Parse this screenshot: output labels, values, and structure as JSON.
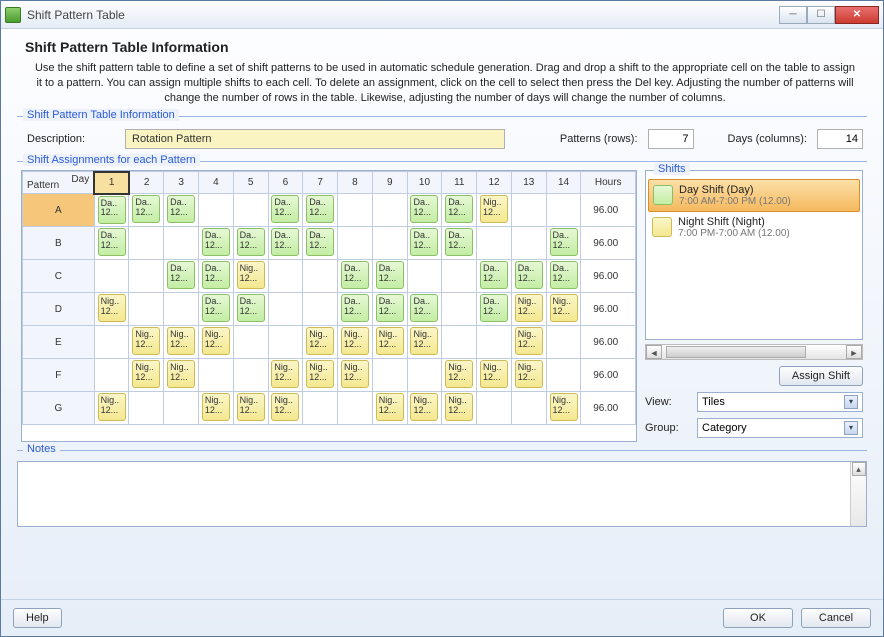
{
  "window": {
    "title": "Shift Pattern Table"
  },
  "page": {
    "heading": "Shift Pattern Table Information",
    "instructions": "Use the shift pattern table to define a set of shift patterns to be used in automatic schedule generation. Drag and drop a shift to the appropriate cell on the table to assign it to a pattern. You can assign multiple shifts to each cell. To delete an assignment, click on the cell to select then press the Del key.  Adjusting the number of patterns will change the number of rows in the table. Likewise, adjusting the number of days will change the number of columns."
  },
  "info": {
    "legend": "Shift Pattern Table Information",
    "description_label": "Description:",
    "description_value": "Rotation Pattern",
    "patterns_label": "Patterns (rows):",
    "patterns_value": "7",
    "days_label": "Days (columns):",
    "days_value": "14"
  },
  "assignments": {
    "legend": "Shift Assignments for each Pattern",
    "corner_day": "Day",
    "corner_pattern": "Pattern",
    "day_headers": [
      "1",
      "2",
      "3",
      "4",
      "5",
      "6",
      "7",
      "8",
      "9",
      "10",
      "11",
      "12",
      "13",
      "14"
    ],
    "hours_header": "Hours",
    "chip_day_top": "Da..",
    "chip_day_bot": "12...",
    "chip_night_top": "Nig..",
    "chip_night_bot": "12...",
    "rows": [
      {
        "label": "A",
        "hours": "96.00",
        "cells": [
          "D",
          "D",
          "D",
          "",
          "",
          "D",
          "D",
          "",
          "",
          "D",
          "D",
          "N",
          "",
          ""
        ]
      },
      {
        "label": "B",
        "hours": "96.00",
        "cells": [
          "D",
          "",
          "",
          "D",
          "D",
          "D",
          "D",
          "",
          "",
          "D",
          "D",
          "",
          "",
          "D"
        ]
      },
      {
        "label": "C",
        "hours": "96.00",
        "cells": [
          "",
          "",
          "D",
          "D",
          "N",
          "",
          "",
          "D",
          "D",
          "",
          "",
          "D",
          "D",
          "D"
        ]
      },
      {
        "label": "D",
        "hours": "96.00",
        "cells": [
          "N",
          "",
          "",
          "D",
          "D",
          "",
          "",
          "D",
          "D",
          "D",
          "",
          "D",
          "N",
          "N"
        ]
      },
      {
        "label": "E",
        "hours": "96.00",
        "cells": [
          "",
          "N",
          "N",
          "N",
          "",
          "",
          "N",
          "N",
          "N",
          "N",
          "",
          "",
          "N",
          ""
        ]
      },
      {
        "label": "F",
        "hours": "96.00",
        "cells": [
          "",
          "N",
          "N",
          "",
          "",
          "N",
          "N",
          "N",
          "",
          "",
          "N",
          "N",
          "N",
          ""
        ]
      },
      {
        "label": "G",
        "hours": "96.00",
        "cells": [
          "N",
          "",
          "",
          "N",
          "N",
          "N",
          "",
          "",
          "N",
          "N",
          "N",
          "",
          "",
          "N"
        ]
      }
    ]
  },
  "shifts": {
    "legend": "Shifts",
    "items": [
      {
        "name": "Day Shift (Day)",
        "detail": "7:00 AM-7:00 PM (12.00)",
        "type": "day",
        "selected": true
      },
      {
        "name": "Night Shift (Night)",
        "detail": "7:00 PM-7:00 AM (12.00)",
        "type": "night",
        "selected": false
      }
    ],
    "assign_label": "Assign Shift",
    "view_label": "View:",
    "view_value": "Tiles",
    "group_label": "Group:",
    "group_value": "Category"
  },
  "notes": {
    "legend": "Notes",
    "value": ""
  },
  "footer": {
    "help": "Help",
    "ok": "OK",
    "cancel": "Cancel"
  }
}
